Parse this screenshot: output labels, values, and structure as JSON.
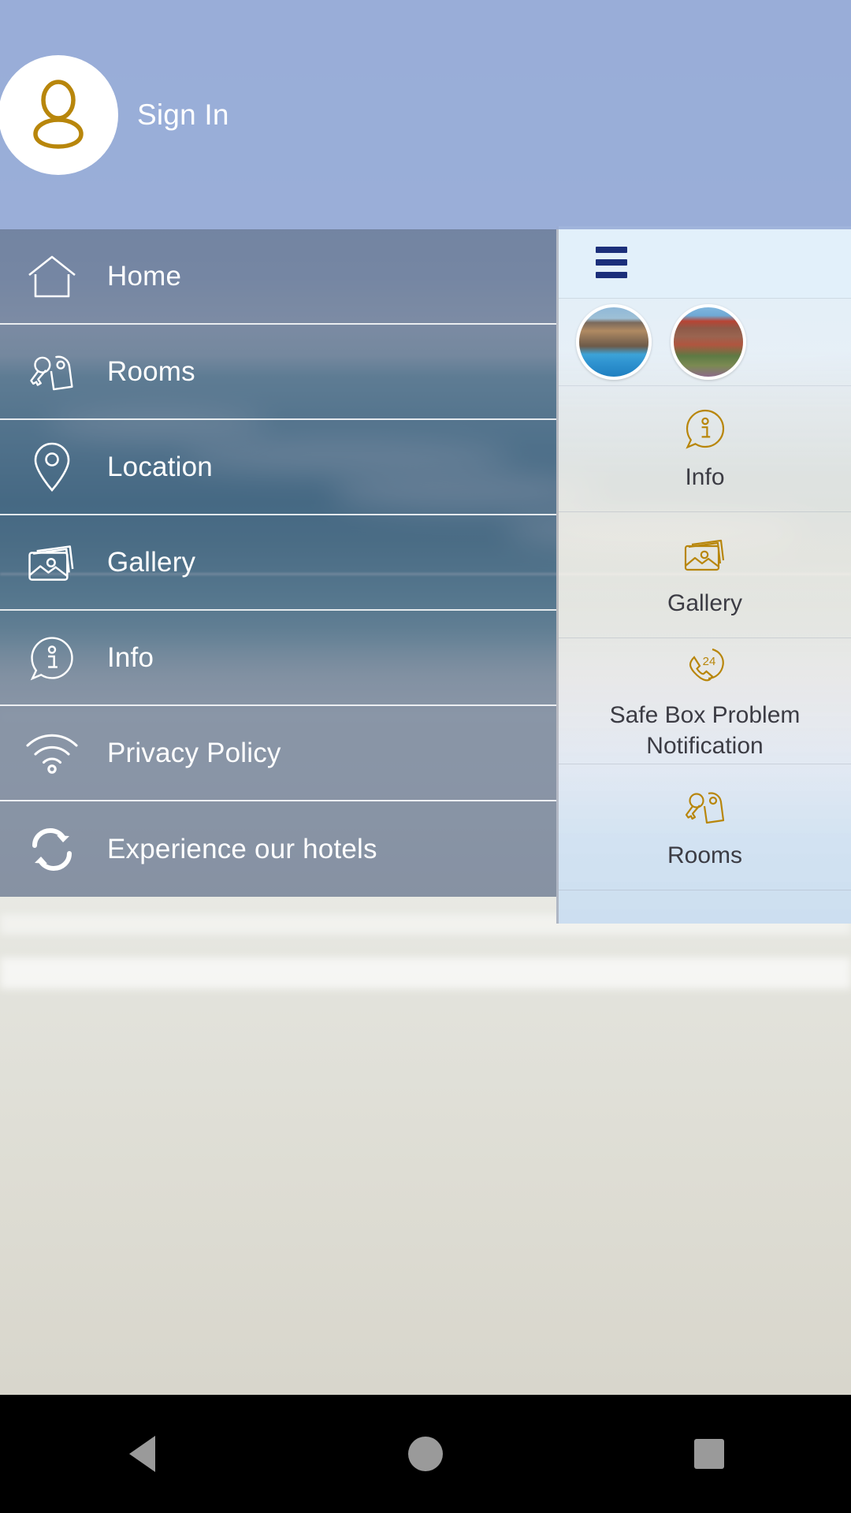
{
  "header": {
    "avatar_icon": "person-icon",
    "signin_label": "Sign In"
  },
  "drawer": {
    "items": [
      {
        "icon": "home-icon",
        "label": "Home"
      },
      {
        "icon": "key-tag-icon",
        "label": "Rooms"
      },
      {
        "icon": "map-pin-icon",
        "label": "Location"
      },
      {
        "icon": "photos-icon",
        "label": "Gallery"
      },
      {
        "icon": "info-bubble-icon",
        "label": "Info"
      },
      {
        "icon": "wifi-icon",
        "label": "Privacy Policy"
      },
      {
        "icon": "refresh-icon",
        "label": "Experience our hotels"
      }
    ]
  },
  "right_panel": {
    "hamburger_icon": "hamburger-icon",
    "thumbnails": [
      {
        "name": "hotel-thumbnail-1"
      },
      {
        "name": "hotel-thumbnail-2"
      }
    ],
    "items": [
      {
        "icon": "info-bubble-icon",
        "label": "Info"
      },
      {
        "icon": "photos-icon",
        "label": "Gallery"
      },
      {
        "icon": "phone-24-icon",
        "label": "Safe Box Problem\nNotification"
      },
      {
        "icon": "key-tag-icon",
        "label": "Rooms"
      }
    ]
  },
  "navbar": {
    "back_label": "Back",
    "home_label": "Home",
    "recent_label": "Recent apps"
  },
  "colors": {
    "header_bg": "#96abd6",
    "drawer_bg": "#4a5c7a",
    "gold": "#b8860b",
    "navy": "#1b2f7a",
    "panel_text": "#3c3c44"
  }
}
